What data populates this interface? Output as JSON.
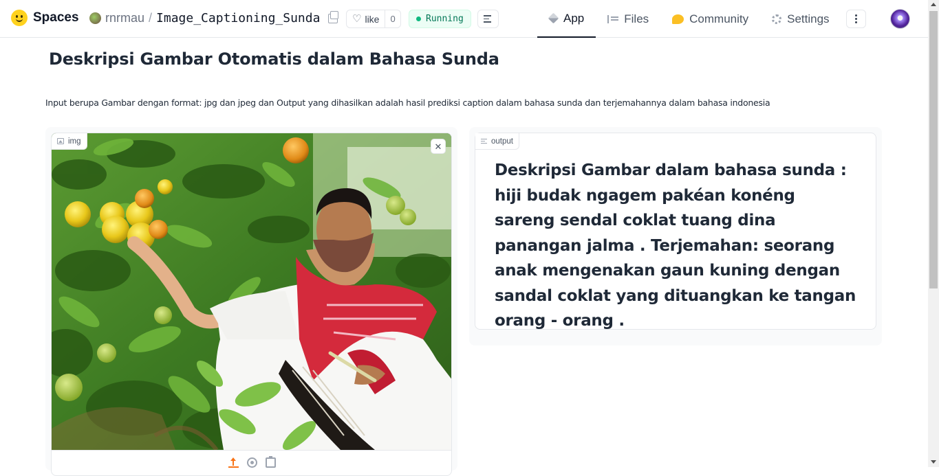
{
  "header": {
    "brand": "Spaces",
    "owner": "rnrmau",
    "separator": "/",
    "repo_name": "Image_Captioning_Sunda",
    "like_label": "like",
    "like_count": "0",
    "status": "Running",
    "tabs": [
      {
        "label": "App",
        "icon": "app-cube-icon",
        "active": true
      },
      {
        "label": "Files",
        "icon": "files-icon",
        "active": false
      },
      {
        "label": "Community",
        "icon": "community-icon",
        "active": false
      },
      {
        "label": "Settings",
        "icon": "gear-icon",
        "active": false
      }
    ]
  },
  "main": {
    "title": "Deskripsi Gambar Otomatis dalam Bahasa Sunda",
    "description": "Input berupa Gambar dengan format: jpg dan jpeg dan Output yang dihasilkan adalah hasil prediksi caption dalam bahasa sunda dan terjemahannya dalam bahasa indonesia",
    "input": {
      "label": "img",
      "image_alt": "photo: man in red scarf picking oranges from a tree"
    },
    "output": {
      "label": "output",
      "text": "Deskripsi Gambar dalam bahasa sunda : hiji budak ngagem pakéan konéng sareng sendal coklat tuang dina panangan jalma . Terjemahan: seorang anak mengenakan gaun kuning dengan sandal coklat yang dituangkan ke tangan orang - orang ."
    }
  },
  "colors": {
    "accent_orange": "#f97316",
    "status_green": "#10b981",
    "brand_yellow": "#ffd21e"
  }
}
